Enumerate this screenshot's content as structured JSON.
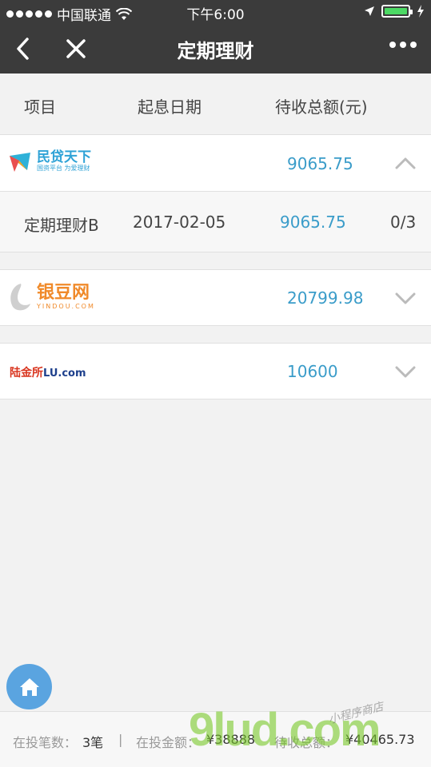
{
  "status_bar": {
    "carrier": "中国联通",
    "time": "下午6:00"
  },
  "nav": {
    "title": "定期理财"
  },
  "table_header": {
    "col_project": "项目",
    "col_start_date": "起息日期",
    "col_amount": "待收总额(元)"
  },
  "platforms": [
    {
      "logo_text": "民贷天下",
      "logo_sub": "国资平台 为爱理财",
      "amount": "9065.75",
      "expanded": true,
      "items": [
        {
          "name": "定期理财B",
          "date": "2017-02-05",
          "amount": "9065.75",
          "progress": "0/3"
        }
      ]
    },
    {
      "logo_text": "银豆网",
      "logo_sub": "YINDOU.COM",
      "amount": "20799.98",
      "expanded": false
    },
    {
      "logo_text": "陆金所",
      "logo_sub": "LU.com",
      "amount": "10600",
      "expanded": false
    }
  ],
  "footer": {
    "count_label": "在投笔数：",
    "count_value": "3笔",
    "separator": "|",
    "invest_label": "在投金额：",
    "invest_value": "¥38888",
    "pending_label": "待收总额：",
    "pending_value": "¥40465.73"
  },
  "watermark": {
    "main": "9lud.com",
    "small": "小程序商店"
  },
  "colors": {
    "accent_blue": "#3a9cc9",
    "nav_bg": "#3b3b3b",
    "home_btn": "#5aa4e0"
  }
}
